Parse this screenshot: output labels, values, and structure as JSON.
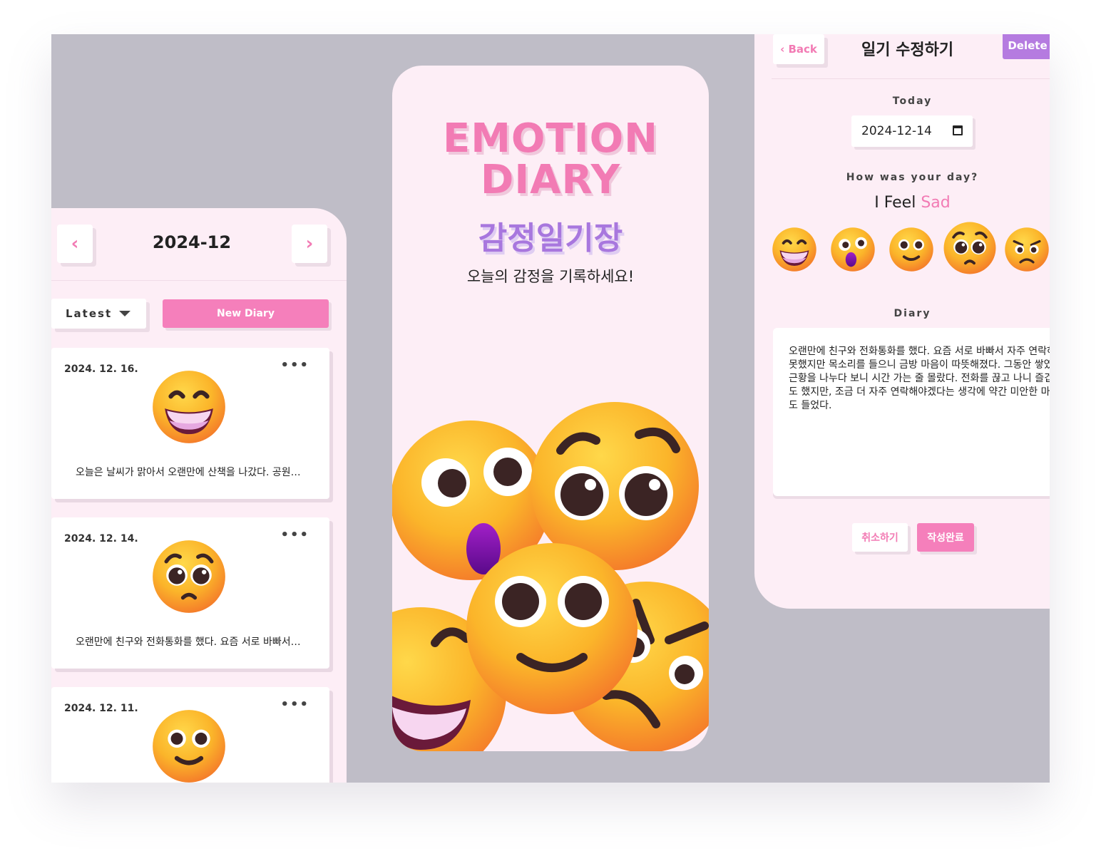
{
  "list_screen": {
    "prev_icon": "chevron-left-icon",
    "next_icon": "chevron-right-icon",
    "month_title": "2024-12",
    "sort_label": "Latest",
    "new_diary_label": "New Diary",
    "entries": [
      {
        "date": "2024. 12. 16.",
        "menu": "•••",
        "emotion": "grinning",
        "preview": "오늘은 날씨가 맑아서 오랜만에 산책을 나갔다. 공원에서 커피를 마셨다"
      },
      {
        "date": "2024. 12. 14.",
        "menu": "•••",
        "emotion": "sad",
        "preview": "오랜만에 친구와 전화통화를 했다. 요즘 서로 바빠서 자주 연락하지"
      },
      {
        "date": "2024. 12. 11.",
        "menu": "•••",
        "emotion": "smiling",
        "preview": ""
      }
    ]
  },
  "intro_screen": {
    "title_en_line1": "EMOTION",
    "title_en_line2": "DIARY",
    "title_ko": "감정일기장",
    "subtitle": "오늘의 감정을 기록하세요!"
  },
  "edit_screen": {
    "back_label": "‹ Back",
    "title": "일기 수정하기",
    "delete_label": "Delete",
    "today_label": "Today",
    "date_value": "2024-12-14",
    "question_label": "How was your day?",
    "feel_prefix": "I Feel",
    "feel_value": "Sad",
    "emotions": [
      "grinning",
      "surprised",
      "smiling",
      "sad",
      "angry"
    ],
    "selected_emotion": "sad",
    "diary_label": "Diary",
    "diary_text": "오랜만에 친구와 전화통화를 했다. 요즘 서로 바빠서 자주 연락하지 못했지만 목소리를 들으니 금방 마음이 따뜻해졌다. 그동안 쌓였던 근황을 나누다 보니 시간 가는 줄 몰랐다. 전화를 끊고 나니 즐겁기도 했지만, 조금 더 자주 연락해야겠다는 생각에 약간 미안한 마음도 들었다.",
    "cancel_label": "취소하기",
    "submit_label": "작성완료"
  },
  "colors": {
    "pink_accent": "#f27bb4",
    "pink_button": "#f57fbb",
    "purple_accent": "#b57be0",
    "screen_bg": "#fdeef6",
    "stage_bg": "#bfbdc7",
    "emoji_yellow": "#fbbf2c",
    "emoji_orange": "#f7902b"
  }
}
